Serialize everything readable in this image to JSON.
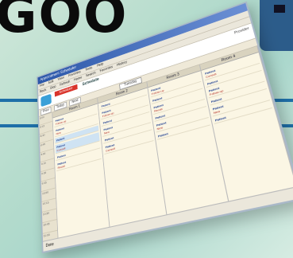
{
  "hero": {
    "text": "GOO"
  },
  "window": {
    "title": "Appointment Scheduler",
    "menu": [
      "File",
      "Edit",
      "View",
      "Favorites",
      "Tools",
      "Help"
    ],
    "toolbar": [
      "Back",
      "Stop",
      "Refresh",
      "Home",
      "Search",
      "Favorites",
      "History"
    ]
  },
  "app": {
    "tab": "Scheduler",
    "title": "Schedule",
    "right_info": "Provider"
  },
  "nav": {
    "buttons": [
      "Prev",
      "Today",
      "Next"
    ],
    "date": "Tuesday"
  },
  "times": [
    "8:00",
    "8:15",
    "8:30",
    "8:45",
    "9:00",
    "9:15",
    "9:30",
    "9:45",
    "10:00",
    "10:15",
    "10:30",
    "10:45",
    "11:00",
    "11:15"
  ],
  "columns": [
    {
      "header": "Room 1",
      "appts": [
        {
          "name": "Patient",
          "note": "Follow-up"
        },
        {
          "name": "Patient",
          "note": "New"
        },
        {
          "name": "Patient",
          "note": ""
        },
        {
          "name": "Patient",
          "note": "Consult"
        },
        {
          "name": "Patient",
          "note": ""
        },
        {
          "name": "Patient",
          "note": "Recall"
        }
      ]
    },
    {
      "header": "Room 2",
      "appts": [
        {
          "name": "Patient",
          "note": ""
        },
        {
          "name": "Patient",
          "note": "Follow-up"
        },
        {
          "name": "Patient",
          "note": ""
        },
        {
          "name": "Patient",
          "note": "New"
        },
        {
          "name": "Patient",
          "note": ""
        },
        {
          "name": "Patient",
          "note": "Consult"
        }
      ]
    },
    {
      "header": "Room 3",
      "appts": [
        {
          "name": "Patient",
          "note": "Follow-up"
        },
        {
          "name": "Patient",
          "note": ""
        },
        {
          "name": "Patient",
          "note": "Recall"
        },
        {
          "name": "Patient",
          "note": ""
        },
        {
          "name": "Patient",
          "note": "New"
        },
        {
          "name": "Patient",
          "note": ""
        }
      ]
    },
    {
      "header": "Room 4",
      "appts": [
        {
          "name": "Patient",
          "note": "Consult"
        },
        {
          "name": "Patient",
          "note": ""
        },
        {
          "name": "Patient",
          "note": "Follow-up"
        },
        {
          "name": "Patient",
          "note": ""
        },
        {
          "name": "Patient",
          "note": "New"
        },
        {
          "name": "Patient",
          "note": ""
        }
      ]
    }
  ],
  "status": {
    "text": "Done"
  },
  "colors": {
    "accent": "#1e6fa8",
    "tab": "#d9342b",
    "panel": "#fbf6e4"
  }
}
